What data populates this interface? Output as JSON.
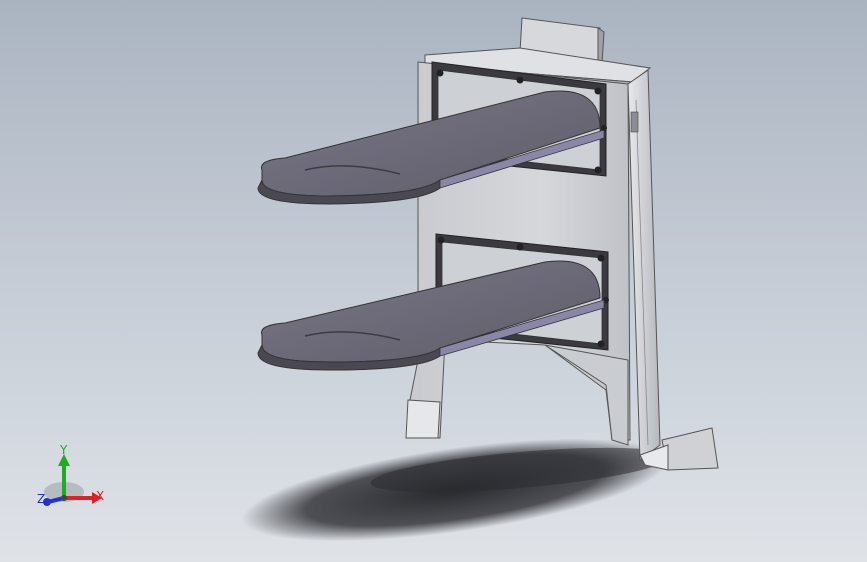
{
  "viewport": {
    "background_top": "#aab4c0",
    "background_bottom": "#dfe3e8"
  },
  "model": {
    "parts": [
      "backplate",
      "side-flange",
      "top-tab",
      "upper-shelf",
      "lower-shelf",
      "upper-mount-plate",
      "lower-mount-plate",
      "bottom-hook",
      "floor-shadow"
    ],
    "colors": {
      "steel_light": "#d4d6da",
      "steel_mid": "#b9bcc2",
      "shelf_top": "#6c6a77",
      "shelf_edge": "#44434c",
      "mount_plate": "#3a3a40",
      "shadow": "#1f2024"
    }
  },
  "triad": {
    "x_label": "X",
    "y_label": "Y",
    "z_label": "Z",
    "x_color": "#dd2222",
    "y_color": "#22aa22",
    "z_color": "#2233cc"
  }
}
